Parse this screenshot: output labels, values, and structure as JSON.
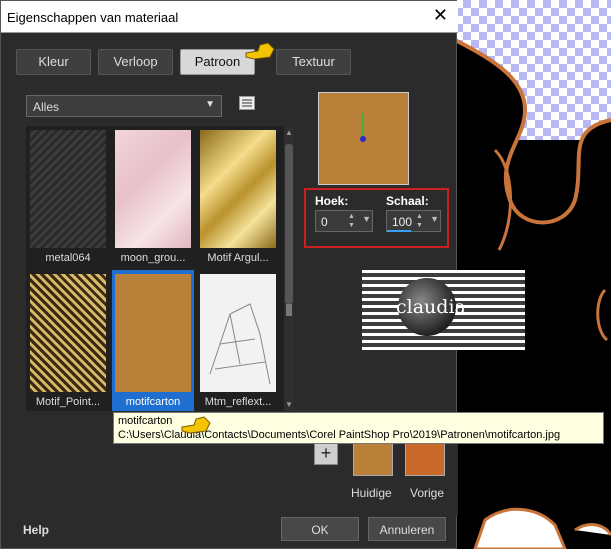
{
  "dialog": {
    "title": "Eigenschappen van materiaal",
    "close_glyph": "✕"
  },
  "tabs": [
    {
      "label": "Kleur"
    },
    {
      "label": "Verloop"
    },
    {
      "label": "Patroon"
    },
    {
      "label": "Textuur"
    }
  ],
  "active_tab": "Patroon",
  "category_select": {
    "value": "Alles"
  },
  "patterns": [
    {
      "label": "metal064"
    },
    {
      "label": "moon_grou..."
    },
    {
      "label": "Motif Argul..."
    },
    {
      "label": "Motif_Point..."
    },
    {
      "label": "motifcarton"
    },
    {
      "label": "Mtm_reflext..."
    }
  ],
  "selected_pattern": "motifcarton",
  "angle": {
    "label": "Hoek:",
    "value": "0"
  },
  "scale": {
    "label": "Schaal:",
    "value": "100"
  },
  "tooltip": {
    "name": "motifcarton",
    "path": "C:\\Users\\Claudia\\Contacts\\Documents\\Corel PaintShop Pro\\2019\\Patronen\\motifcarton.jpg"
  },
  "swatches": {
    "current_label": "Huidige",
    "previous_label": "Vorige",
    "current_color": "#b9803a",
    "previous_color": "#c9692a"
  },
  "watermark": {
    "text": "claudia"
  },
  "footer": {
    "help": "Help",
    "ok": "OK",
    "cancel": "Annuleren"
  },
  "colors": {
    "accent": "#1e6fd0",
    "highlight_border": "#cc2020"
  }
}
